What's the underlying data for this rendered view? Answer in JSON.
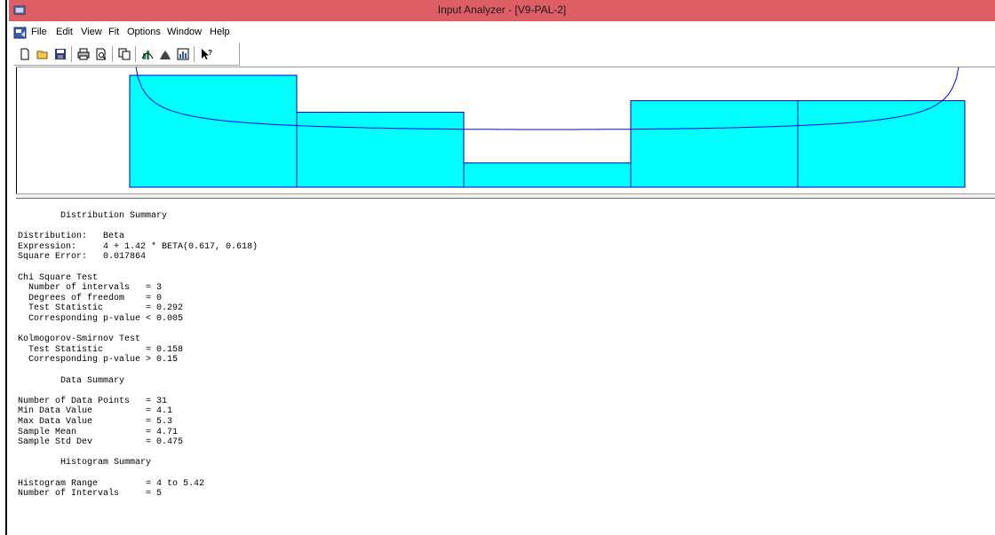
{
  "window": {
    "title": "Input Analyzer - [V9-PAL-2]"
  },
  "menu": [
    "File",
    "Edit",
    "View",
    "Fit",
    "Options",
    "Window",
    "Help"
  ],
  "toolbar": {
    "buttons": [
      "new-icon",
      "open-icon",
      "save-icon",
      "print-icon",
      "print-preview-icon",
      "copy-icon",
      "fit-data-icon",
      "histogram-icon",
      "chart-icon",
      "help-icon"
    ]
  },
  "colors": {
    "titlebar": "#de5e66",
    "histogram_fill": "#00ffff",
    "histogram_edge": "#0000cc",
    "fit_curve": "#0000ff"
  },
  "chart_data": {
    "type": "bar",
    "title": "",
    "xlabel": "",
    "ylabel": "",
    "xlim": [
      4,
      5.42
    ],
    "bins": [
      {
        "from": 4.0,
        "to": 4.284,
        "relative_frequency": 0.97
      },
      {
        "from": 4.284,
        "to": 4.568,
        "relative_frequency": 0.65
      },
      {
        "from": 4.568,
        "to": 4.852,
        "relative_frequency": 0.21
      },
      {
        "from": 4.852,
        "to": 5.136,
        "relative_frequency": 0.75
      },
      {
        "from": 5.136,
        "to": 5.42,
        "relative_frequency": 0.75
      }
    ],
    "fitted_curve": {
      "distribution": "Beta",
      "alpha": 0.617,
      "beta": 0.618
    },
    "grid": false
  },
  "report": {
    "lines": [
      "        Distribution Summary",
      "",
      "Distribution:   Beta",
      "Expression:     4 + 1.42 * BETA(0.617, 0.618)",
      "Square Error:   0.017864",
      "",
      "Chi Square Test",
      "  Number of intervals   = 3",
      "  Degrees of freedom    = 0",
      "  Test Statistic        = 0.292",
      "  Corresponding p-value < 0.005",
      "",
      "Kolmogorov-Smirnov Test",
      "  Test Statistic        = 0.158",
      "  Corresponding p-value > 0.15",
      "",
      "        Data Summary",
      "",
      "Number of Data Points   = 31",
      "Min Data Value          = 4.1",
      "Max Data Value          = 5.3",
      "Sample Mean             = 4.71",
      "Sample Std Dev          = 0.475",
      "",
      "        Histogram Summary",
      "",
      "Histogram Range         = 4 to 5.42",
      "Number of Intervals     = 5"
    ]
  }
}
